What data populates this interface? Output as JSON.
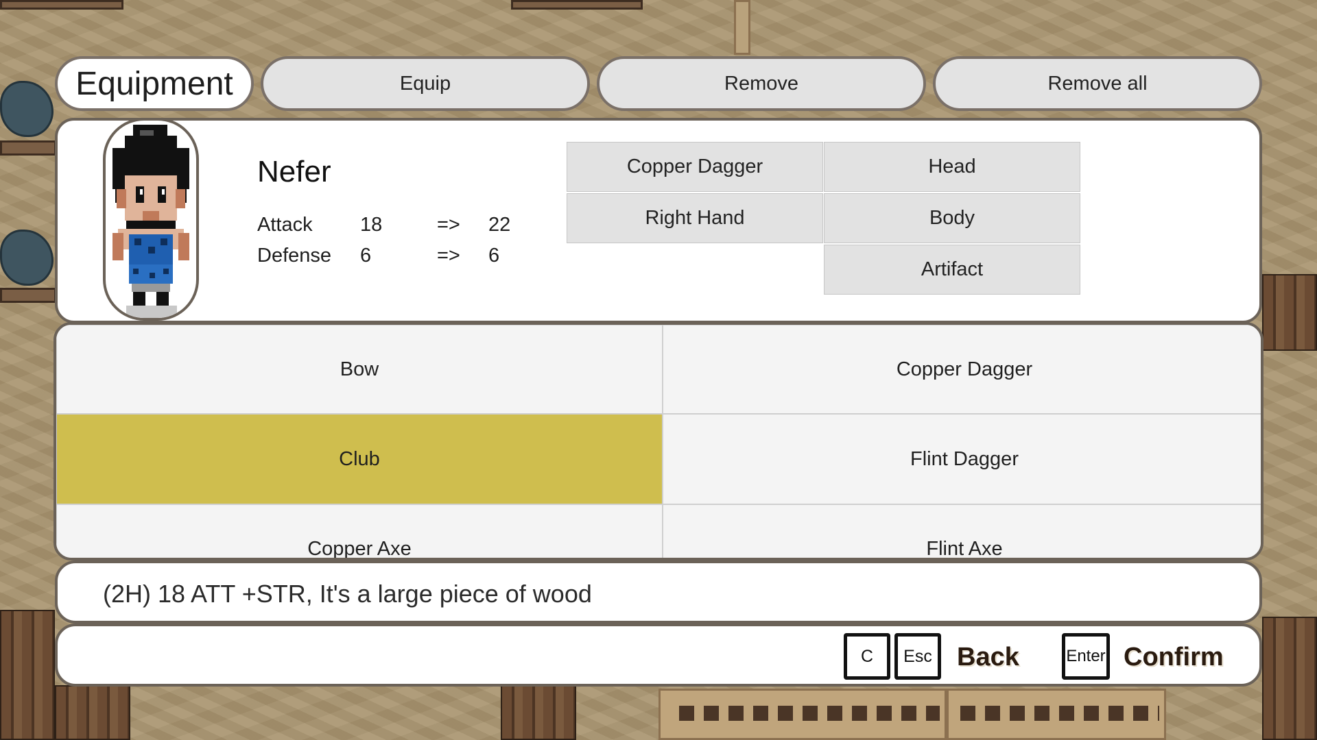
{
  "menu": {
    "title": "Equipment",
    "tabs": [
      "Equip",
      "Remove",
      "Remove all"
    ]
  },
  "character": {
    "name": "Nefer",
    "sprite_icon": "character-portrait",
    "stats": [
      {
        "label": "Attack",
        "current": "18",
        "arrow": "=>",
        "new": "22"
      },
      {
        "label": "Defense",
        "current": "6",
        "arrow": "=>",
        "new": "6"
      }
    ]
  },
  "slots": [
    {
      "label": "Copper Dagger"
    },
    {
      "label": "Head"
    },
    {
      "label": "Right Hand"
    },
    {
      "label": "Body"
    },
    {
      "label": "Artifact"
    }
  ],
  "items": [
    {
      "label": "Bow",
      "selected": false
    },
    {
      "label": "Copper Dagger",
      "selected": false
    },
    {
      "label": "Club",
      "selected": true
    },
    {
      "label": "Flint Dagger",
      "selected": false
    },
    {
      "label": "Copper Axe",
      "selected": false
    },
    {
      "label": "Flint Axe",
      "selected": false
    }
  ],
  "description": "(2H) 18 ATT +STR, It's a large piece of wood",
  "controls": {
    "back_keys": [
      "C",
      "Esc"
    ],
    "back_label": "Back",
    "confirm_key": "Enter",
    "confirm_label": "Confirm"
  },
  "colors": {
    "selected_item": "#cfbe4e",
    "panel": "#ffffff",
    "tab": "#e3e3e3"
  }
}
